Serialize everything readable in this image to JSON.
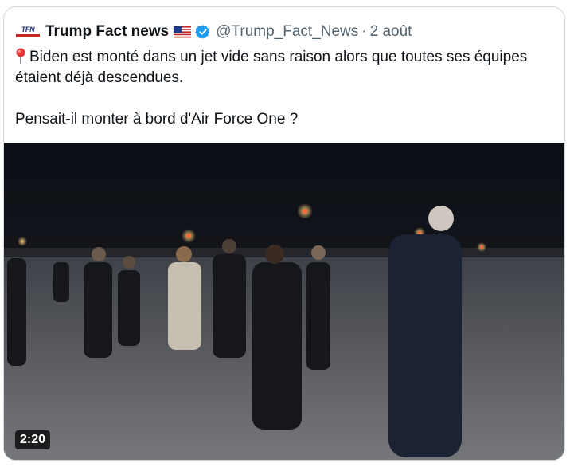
{
  "tweet": {
    "account_name": "Trump Fact news",
    "avatar_text": "TFN",
    "flag_emoji_name": "us-flag-icon",
    "verified_color": "#1d9bf0",
    "handle": "@Trump_Fact_News",
    "separator": "·",
    "date": "2 août",
    "line1": "Biden est monté dans un jet vide sans raison alors que toutes ses équipes étaient déjà descendues.",
    "line2": "Pensait-il monter à bord d'Air Force One ?",
    "pin_icon": "round-pushpin-icon"
  },
  "media": {
    "duration": "2:20"
  }
}
